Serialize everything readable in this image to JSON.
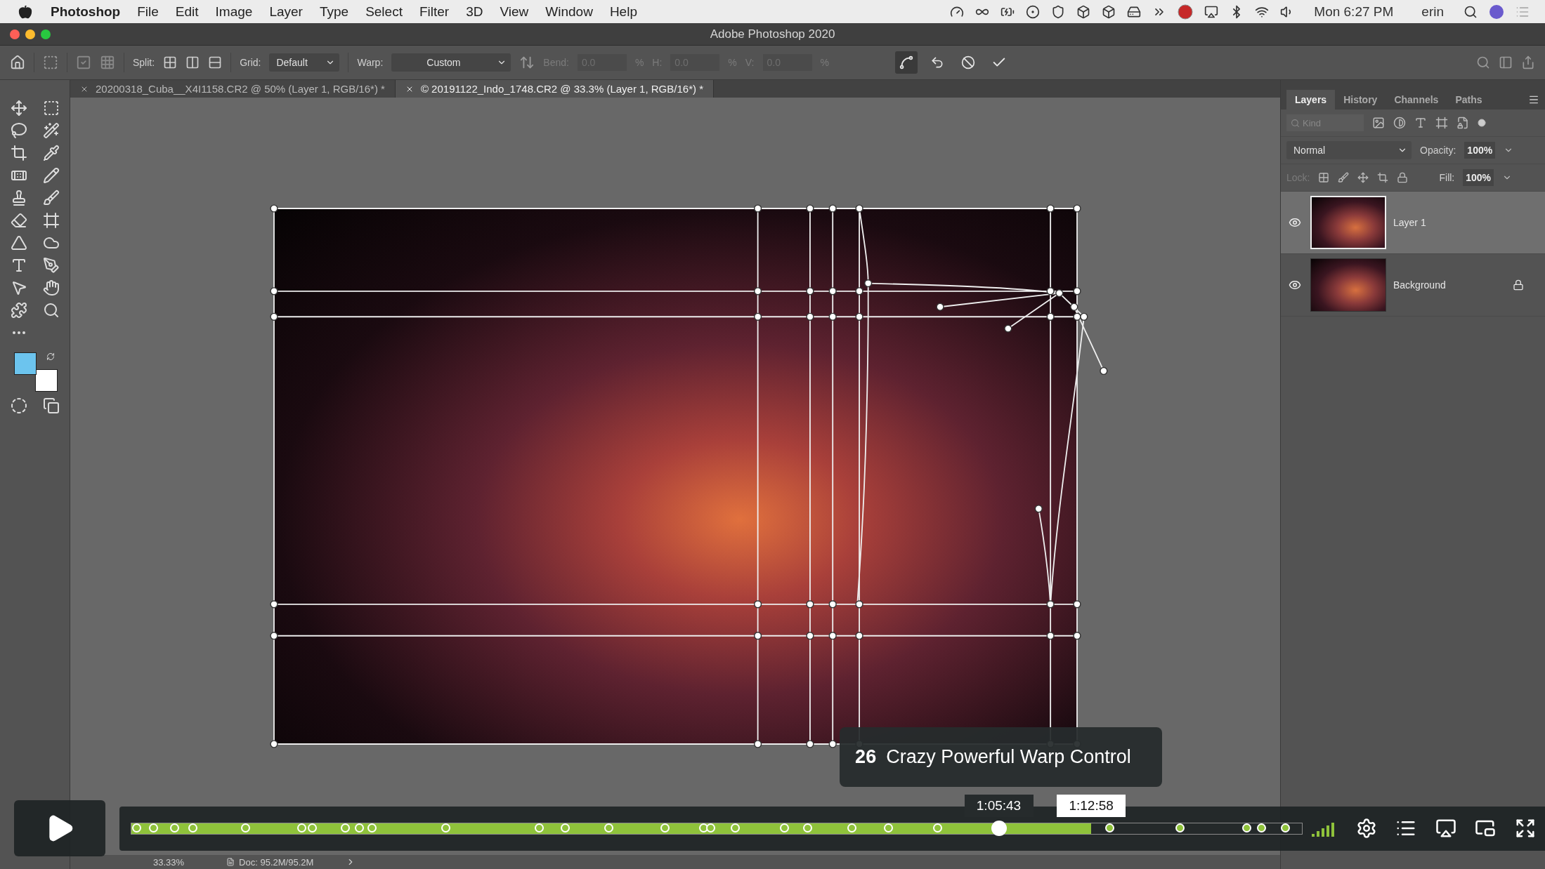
{
  "menu_bar": {
    "app_name": "Photoshop",
    "menus": [
      "File",
      "Edit",
      "Image",
      "Layer",
      "Type",
      "Select",
      "Filter",
      "3D",
      "View",
      "Window",
      "Help"
    ],
    "clock": "Mon 6:27 PM",
    "user": "erin"
  },
  "window": {
    "title": "Adobe Photoshop 2020"
  },
  "options_bar": {
    "split_label": "Split:",
    "grid_label": "Grid:",
    "grid_value": "Default",
    "warp_label": "Warp:",
    "warp_value": "Custom",
    "fields": [
      {
        "label": "Bend:",
        "value": "0.0",
        "unit": "%",
        "disabled": true
      },
      {
        "label": "H:",
        "value": "0.0",
        "unit": "%",
        "disabled": true
      },
      {
        "label": "V:",
        "value": "0.0",
        "unit": "%",
        "disabled": true
      }
    ]
  },
  "document_tabs": [
    {
      "label": "20200318_Cuba__X4I1158.CR2 @ 50% (Layer 1, RGB/16*) *",
      "selected": false
    },
    {
      "label": "© 20191122_Indo_1748.CR2 @ 33.3% (Layer 1, RGB/16*) *",
      "selected": true
    }
  ],
  "swatches": [
    {
      "kind": "foreground",
      "color": "#6cc4ee"
    },
    {
      "kind": "background",
      "color": "#ffffff"
    }
  ],
  "layers_panel": {
    "tabs": [
      {
        "label": "Layers",
        "selected": true
      },
      {
        "label": "History",
        "selected": false
      },
      {
        "label": "Channels",
        "selected": false
      },
      {
        "label": "Paths",
        "selected": false
      }
    ],
    "filter_placeholder": "Kind",
    "blend_mode": "Normal",
    "opacity_label": "Opacity:",
    "opacity": "100%",
    "lock_label": "Lock:",
    "fill_label": "Fill:",
    "fill": "100%",
    "layers": [
      {
        "name": "Layer 1",
        "visible": true,
        "selected": true,
        "locked": false
      },
      {
        "name": "Background",
        "visible": true,
        "selected": false,
        "locked": true
      }
    ]
  },
  "status_bar": {
    "zoom": "33.33%",
    "doc_info": "Doc: 95.2M/95.2M"
  },
  "video_player": {
    "chapter": {
      "number": "26",
      "title": "Crazy Powerful Warp Control"
    },
    "playhead": {
      "level": 0.741,
      "time": "1:05:43"
    },
    "hover": {
      "level": 0.82,
      "time": "1:12:58"
    },
    "chapter_markers": [
      {
        "level": 0.005
      },
      {
        "level": 0.019
      },
      {
        "level": 0.037
      },
      {
        "level": 0.053
      },
      {
        "level": 0.098
      },
      {
        "level": 0.146
      },
      {
        "level": 0.155
      },
      {
        "level": 0.183
      },
      {
        "level": 0.195
      },
      {
        "level": 0.206
      },
      {
        "level": 0.269
      },
      {
        "level": 0.349
      },
      {
        "level": 0.371
      },
      {
        "level": 0.408
      },
      {
        "level": 0.456
      },
      {
        "level": 0.489
      },
      {
        "level": 0.495
      },
      {
        "level": 0.516
      },
      {
        "level": 0.558
      },
      {
        "level": 0.578
      },
      {
        "level": 0.616
      },
      {
        "level": 0.647
      },
      {
        "level": 0.689
      },
      {
        "level": 0.836
      },
      {
        "level": 0.896
      },
      {
        "level": 0.953
      },
      {
        "level": 0.966
      },
      {
        "level": 0.986
      }
    ]
  }
}
